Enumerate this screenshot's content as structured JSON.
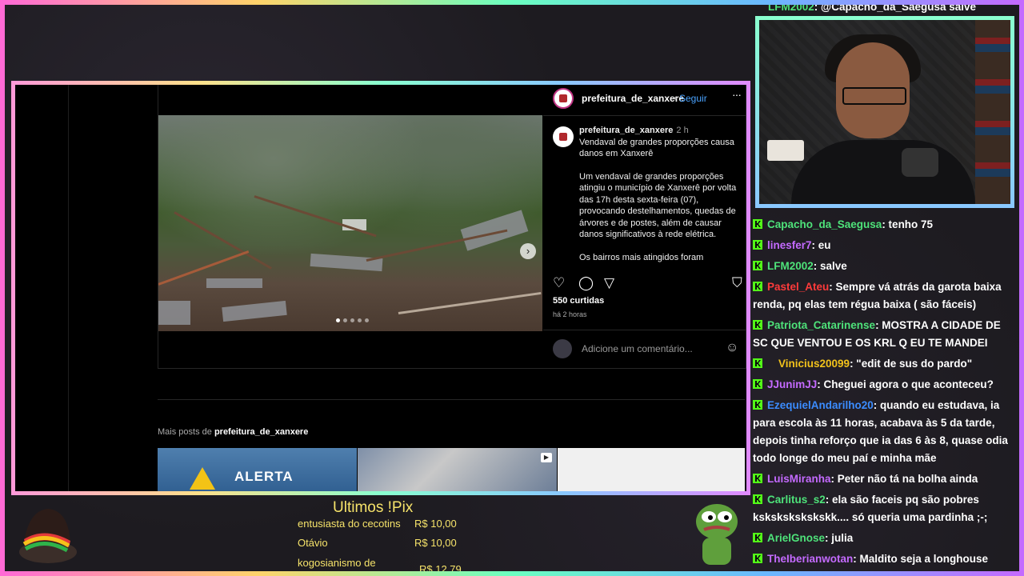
{
  "instagram": {
    "post_header": {
      "username": "prefeitura_de_xanxere",
      "separator": "•",
      "follow_label": "Seguir",
      "more_label": "···"
    },
    "caption": {
      "username": "prefeitura_de_xanxere",
      "time": "2 h",
      "title": "Vendaval de grandes proporções causa danos em Xanxerê",
      "body": "Um vendaval de grandes proporções atingiu o município de Xanxerê por volta das 17h desta sexta-feira (07), provocando destelhamentos, quedas de árvores e de postes, além de causar danos significativos à rede elétrica.",
      "body2": "Os bairros mais atingidos foram"
    },
    "actions": {
      "like_icon": "heart-icon",
      "comment_icon": "comment-icon",
      "share_icon": "share-icon",
      "save_icon": "bookmark-icon"
    },
    "likes": "550 curtidas",
    "posted_ago": "há 2 horas",
    "comment_placeholder": "Adicione um comentário...",
    "more_posts_prefix": "Mais posts de",
    "more_posts_user": "prefeitura_de_xanxere",
    "thumb1_text": "ALERTA"
  },
  "chat": {
    "top_partial": {
      "user": "LFM2002",
      "text": ": @Capacho_da_Saegusa salve",
      "color": "#4ee37a"
    },
    "messages": [
      {
        "user": "Capacho_da_Saegusa",
        "text": ": tenho 75",
        "color": "#4ee37a"
      },
      {
        "user": "linesfer7",
        "text": ": eu",
        "color": "#c46aff"
      },
      {
        "user": "LFM2002",
        "text": ": salve",
        "color": "#4ee37a"
      },
      {
        "user": "Pastel_Ateu",
        "text": ": Sempre vá atrás da garota baixa renda, pq elas tem régua baixa ( são fáceis)",
        "color": "#ff3b3b"
      },
      {
        "user": "Patriota_Catarinense",
        "text": ": MOSTRA A CIDADE DE SC QUE VENTOU E OS KRL Q EU TE MANDEI",
        "color": "#4ee37a"
      },
      {
        "user": "Vinicius20099",
        "text": ": \"edit de sus do pardo\"",
        "color": "#f2c21b"
      },
      {
        "user": "JJunimJJ",
        "text": ": Cheguei agora o que aconteceu?",
        "color": "#c46aff"
      },
      {
        "user": "EzequielAndarilho20",
        "text": ": quando eu estudava, ia para escola às 11 horas, acabava às 5 da tarde, depois tinha reforço que ia das 6 às 8, quase odia todo longe do meu paí e minha mãe",
        "color": "#3b8cff"
      },
      {
        "user": "LuisMiranha",
        "text": ": Peter não tá na bolha ainda",
        "color": "#c46aff"
      },
      {
        "user": "Carlitus_s2",
        "text": ": ela são faceis pq são pobres kskskskskskskk.... só queria uma pardinha ;-;",
        "color": "#4ee37a"
      },
      {
        "user": "ArielGnose",
        "text": ": julia",
        "color": "#4ee37a"
      },
      {
        "user": "TheIberianwotan",
        "text": ": Maldito seja a longhouse",
        "color": "#c46aff"
      }
    ]
  },
  "pix": {
    "title": "Ultimos !Pix",
    "rows": [
      {
        "name": "entusiasta do cecotins",
        "amount": "R$ 10,00"
      },
      {
        "name": "Otávio",
        "amount": "R$ 10,00"
      },
      {
        "name": "kogosianismo de",
        "amount": "R$ 12,79"
      }
    ]
  },
  "colors": {
    "accent_green": "#4ee37a",
    "link_blue": "#4aa3ff",
    "pix_yellow": "#f6e36a"
  }
}
